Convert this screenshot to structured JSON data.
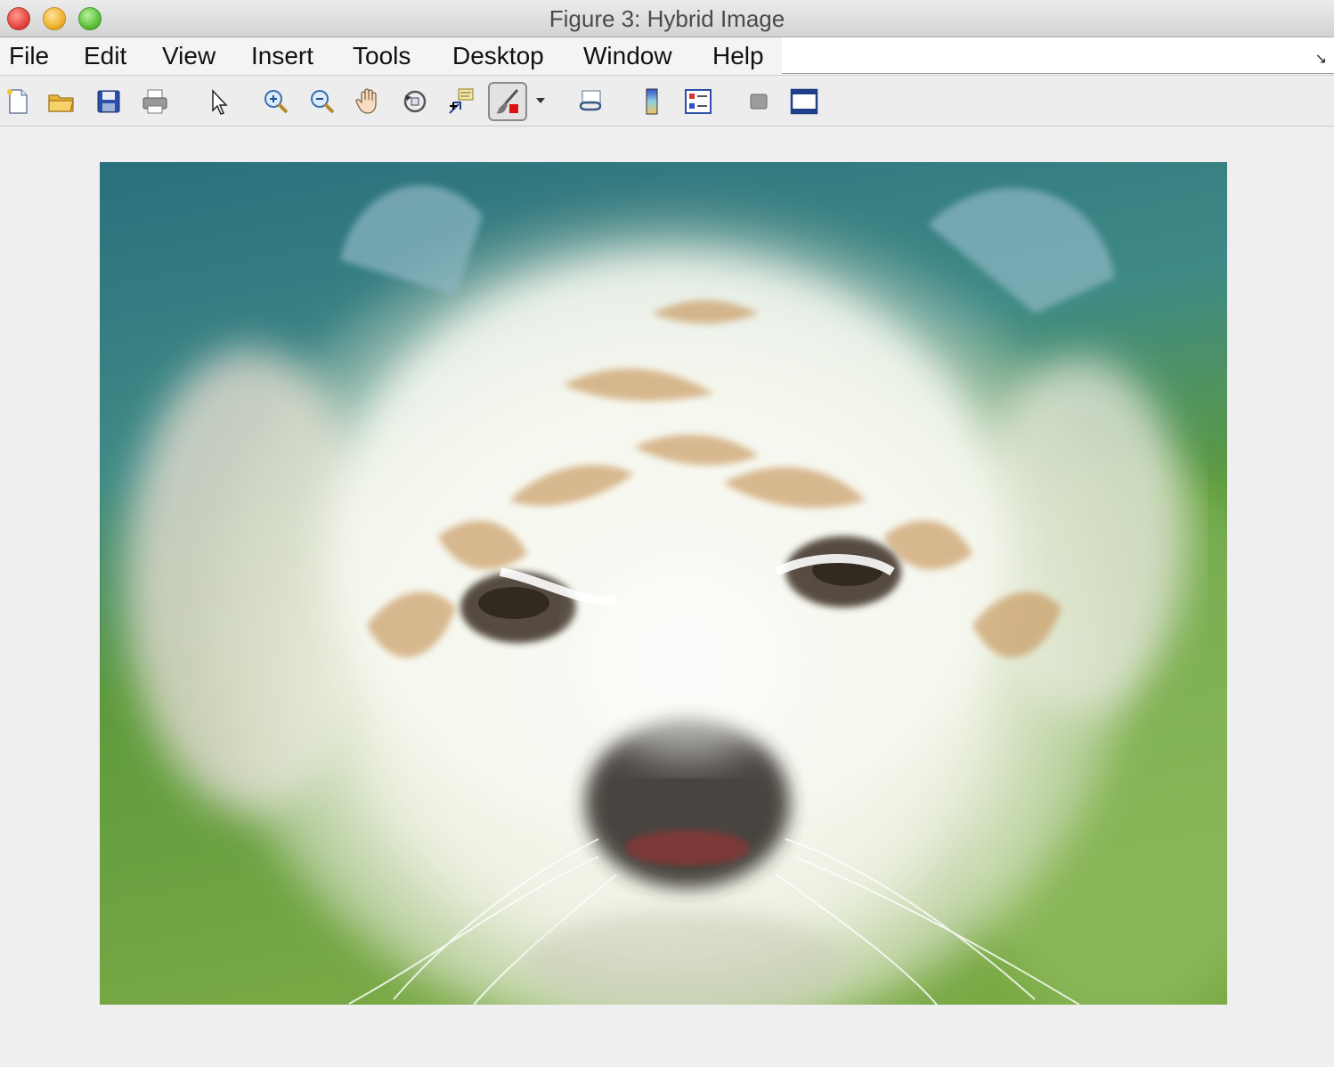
{
  "window": {
    "title": "Figure 3: Hybrid Image"
  },
  "menu": {
    "items": [
      "File",
      "Edit",
      "View",
      "Insert",
      "Tools",
      "Desktop",
      "Window",
      "Help"
    ]
  },
  "toolbar": {
    "buttons": [
      {
        "name": "new-figure",
        "icon": "new-file-icon"
      },
      {
        "name": "open-file",
        "icon": "open-folder-icon"
      },
      {
        "name": "save-figure",
        "icon": "save-icon"
      },
      {
        "name": "print-figure",
        "icon": "printer-icon"
      },
      {
        "name": "edit-plot",
        "icon": "arrow-pointer-icon"
      },
      {
        "name": "zoom-in",
        "icon": "zoom-in-icon"
      },
      {
        "name": "zoom-out",
        "icon": "zoom-out-icon"
      },
      {
        "name": "pan",
        "icon": "hand-icon"
      },
      {
        "name": "rotate-3d",
        "icon": "rotate-3d-icon"
      },
      {
        "name": "data-cursor",
        "icon": "data-cursor-icon"
      },
      {
        "name": "brush",
        "icon": "brush-icon",
        "pressed": true
      },
      {
        "name": "link-plot",
        "icon": "link-icon"
      },
      {
        "name": "insert-colorbar",
        "icon": "colorbar-icon"
      },
      {
        "name": "insert-legend",
        "icon": "legend-icon"
      },
      {
        "name": "hide-plot-tools",
        "icon": "hide-tools-icon"
      },
      {
        "name": "show-plot-tools",
        "icon": "show-tools-icon"
      }
    ]
  },
  "figure": {
    "content": "hybrid-image",
    "colors": {
      "background_teal": "#2f7d86",
      "background_green": "#5c9b33",
      "fur_white": "#f2f4ea"
    }
  }
}
